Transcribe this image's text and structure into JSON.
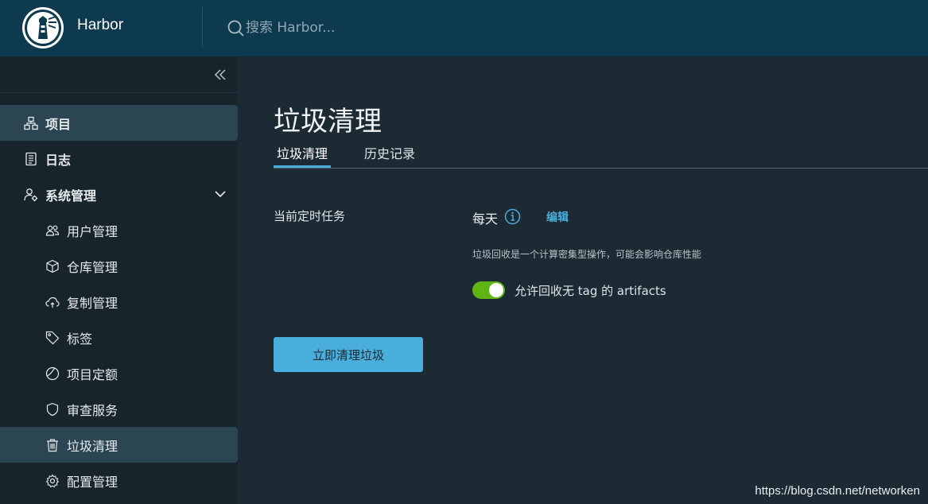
{
  "header": {
    "brand": "Harbor",
    "search_placeholder": "搜索 Harbor..."
  },
  "sidebar": {
    "items": [
      {
        "label": "项目",
        "icon": "projects-icon",
        "active": true
      },
      {
        "label": "日志",
        "icon": "logs-icon",
        "active": false
      },
      {
        "label": "系统管理",
        "icon": "admin-icon",
        "active": false,
        "expanded": true
      },
      {
        "label": "用户管理",
        "icon": "users-icon"
      },
      {
        "label": "仓库管理",
        "icon": "registry-icon"
      },
      {
        "label": "复制管理",
        "icon": "replication-icon"
      },
      {
        "label": "标签",
        "icon": "tag-icon"
      },
      {
        "label": "项目定额",
        "icon": "quota-icon"
      },
      {
        "label": "审查服务",
        "icon": "shield-icon"
      },
      {
        "label": "垃圾清理",
        "icon": "trash-icon",
        "active": true
      },
      {
        "label": "配置管理",
        "icon": "gear-icon"
      }
    ]
  },
  "main": {
    "title": "垃圾清理",
    "tabs": [
      {
        "label": "垃圾清理",
        "active": true
      },
      {
        "label": "历史记录",
        "active": false
      }
    ],
    "schedule": {
      "label": "当前定时任务",
      "value": "每天",
      "edit_label": "编辑",
      "help": "垃圾回收是一个计算密集型操作，可能会影响仓库性能"
    },
    "toggle": {
      "label": "允许回收无 tag 的 artifacts",
      "on": true
    },
    "gc_button_label": "立即清理垃圾"
  },
  "watermark": "https://blog.csdn.net/networken",
  "colors": {
    "header_bg": "#0e3a4f",
    "sidebar_bg": "#17242b",
    "main_bg": "#1c2a33",
    "accent": "#49aedb",
    "toggle_on": "#60b515"
  }
}
